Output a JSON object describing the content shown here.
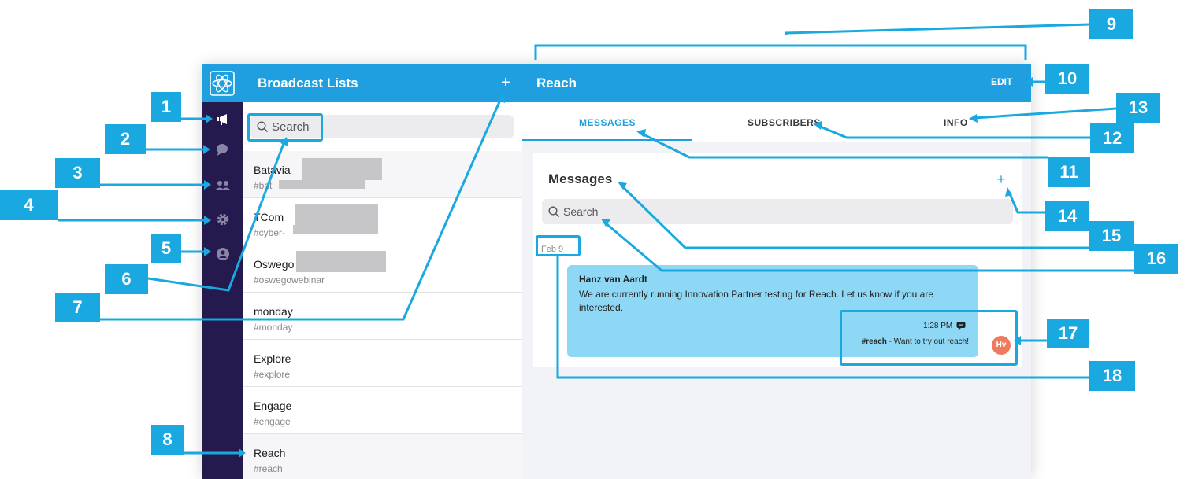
{
  "list": {
    "title": "Broadcast Lists",
    "add_label": "+",
    "search_placeholder": "Search",
    "items": [
      {
        "name": "Batavia",
        "tag": "#bat"
      },
      {
        "name": "TCom",
        "tag": "#cyber-"
      },
      {
        "name": "Oswego",
        "tag": "#oswegowebinar"
      },
      {
        "name": "monday",
        "tag": "#monday"
      },
      {
        "name": "Explore",
        "tag": "#explore"
      },
      {
        "name": "Engage",
        "tag": "#engage"
      },
      {
        "name": "Reach",
        "tag": "#reach"
      }
    ]
  },
  "detail": {
    "title": "Reach",
    "edit_label": "EDIT",
    "tabs": [
      "MESSAGES",
      "SUBSCRIBERS",
      "INFO"
    ],
    "active_tab": "MESSAGES",
    "messages_title": "Messages",
    "add_label": "+",
    "search_placeholder": "Search",
    "date_chip": "Feb 9",
    "message": {
      "author": "Hanz van Aardt",
      "text": "We are currently running Innovation Partner testing for Reach.  Let us know if you are interested.",
      "time": "1:28 PM",
      "channel": "#reach",
      "footer_rest": " - Want to try out reach!",
      "avatar_initials": "Hv"
    }
  },
  "rail": {
    "icons": [
      "logo-icon",
      "broadcast-icon",
      "chat-icon",
      "people-icon",
      "gear-icon",
      "user-circle-icon"
    ]
  },
  "callouts": [
    "1",
    "2",
    "3",
    "4",
    "5",
    "6",
    "7",
    "8",
    "9",
    "10",
    "11",
    "12",
    "13",
    "14",
    "15",
    "16",
    "17",
    "18"
  ],
  "colors": {
    "header_blue": "#1f9fe0",
    "rail_purple": "#241a4e",
    "callout_blue": "#1aa8e0",
    "bubble_blue": "#8ed8f5",
    "avatar_orange": "#ef7b5c"
  }
}
